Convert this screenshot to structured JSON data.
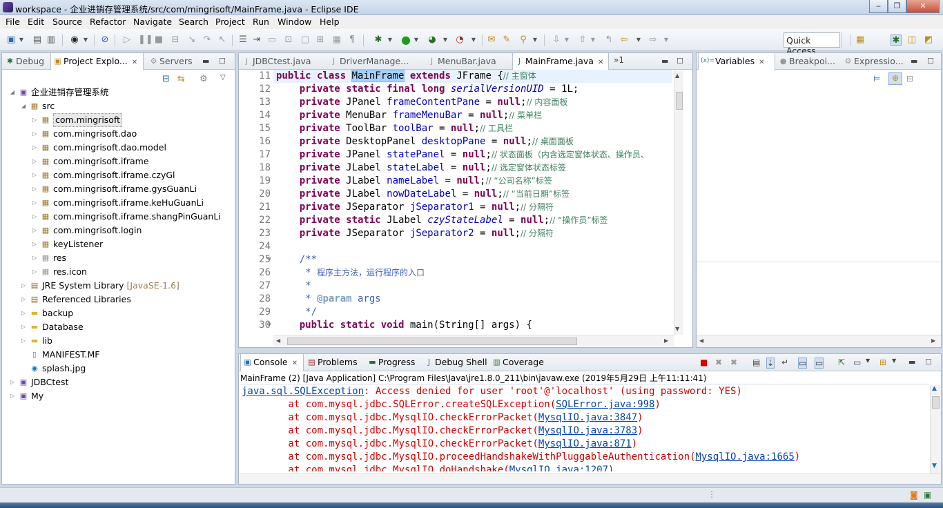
{
  "window": {
    "title": "workspace - 企业进销存管理系统/src/com/mingrisoft/MainFrame.java - Eclipse IDE",
    "minimize": "‒",
    "maximize": "❐",
    "close": "✕"
  },
  "menu": [
    "File",
    "Edit",
    "Source",
    "Refactor",
    "Navigate",
    "Search",
    "Project",
    "Run",
    "Window",
    "Help"
  ],
  "quick_access": "Quick Access",
  "left_tabs": [
    {
      "label": "Debug",
      "active": false
    },
    {
      "label": "Project Explo...",
      "active": true
    },
    {
      "label": "Servers",
      "active": false
    }
  ],
  "tree": [
    {
      "label": "企业进销存管理系统",
      "depth": 0,
      "exp": "◢",
      "icon": "project"
    },
    {
      "label": "src",
      "depth": 1,
      "exp": "◢",
      "icon": "src"
    },
    {
      "label": "com.mingrisoft",
      "depth": 2,
      "exp": "▷",
      "icon": "pkg",
      "selected": true
    },
    {
      "label": "com.mingrisoft.dao",
      "depth": 2,
      "exp": "▷",
      "icon": "pkg"
    },
    {
      "label": "com.mingrisoft.dao.model",
      "depth": 2,
      "exp": "▷",
      "icon": "pkg"
    },
    {
      "label": "com.mingrisoft.iframe",
      "depth": 2,
      "exp": "▷",
      "icon": "pkg"
    },
    {
      "label": "com.mingrisoft.iframe.czyGl",
      "depth": 2,
      "exp": "▷",
      "icon": "pkg"
    },
    {
      "label": "com.mingrisoft.iframe.gysGuanLi",
      "depth": 2,
      "exp": "▷",
      "icon": "pkg"
    },
    {
      "label": "com.mingrisoft.iframe.keHuGuanLi",
      "depth": 2,
      "exp": "▷",
      "icon": "pkg"
    },
    {
      "label": "com.mingrisoft.iframe.shangPinGuanLi",
      "depth": 2,
      "exp": "▷",
      "icon": "pkg"
    },
    {
      "label": "com.mingrisoft.login",
      "depth": 2,
      "exp": "▷",
      "icon": "pkg"
    },
    {
      "label": "keyListener",
      "depth": 2,
      "exp": "▷",
      "icon": "pkg"
    },
    {
      "label": "res",
      "depth": 2,
      "exp": "▷",
      "icon": "pkgempty"
    },
    {
      "label": "res.icon",
      "depth": 2,
      "exp": "▷",
      "icon": "pkgempty"
    },
    {
      "label": "JRE System Library",
      "suffix": "[JavaSE-1.6]",
      "depth": 1,
      "exp": "▷",
      "icon": "lib"
    },
    {
      "label": "Referenced Libraries",
      "depth": 1,
      "exp": "▷",
      "icon": "lib"
    },
    {
      "label": "backup",
      "depth": 1,
      "exp": "▷",
      "icon": "folder"
    },
    {
      "label": "Database",
      "depth": 1,
      "exp": "▷",
      "icon": "folder"
    },
    {
      "label": "lib",
      "depth": 1,
      "exp": "▷",
      "icon": "folder"
    },
    {
      "label": "MANIFEST.MF",
      "depth": 1,
      "exp": "",
      "icon": "file"
    },
    {
      "label": "splash.jpg",
      "depth": 1,
      "exp": "",
      "icon": "image"
    },
    {
      "label": "JDBCtest",
      "depth": 0,
      "exp": "▷",
      "icon": "project"
    },
    {
      "label": "My",
      "depth": 0,
      "exp": "▷",
      "icon": "project"
    }
  ],
  "editor_tabs": [
    {
      "label": "JDBCtest.java",
      "active": false
    },
    {
      "label": "DriverManage...",
      "active": false
    },
    {
      "label": "MenuBar.java",
      "active": false
    },
    {
      "label": "MainFrame.java",
      "active": true
    }
  ],
  "editor_overflow": "»1",
  "code": [
    {
      "n": "11",
      "h": "<span class=\"kw\">public class</span> <span class=\"hl\">MainFrame</span> <span class=\"kw\">extends</span> JFrame {<span class=\"cm\">// 主窗体</span>"
    },
    {
      "n": "12",
      "h": "    <span class=\"kw\">private static final long</span> <span class=\"sfld\">serialVersionUID</span> = 1L;"
    },
    {
      "n": "13",
      "h": "    <span class=\"kw\">private</span> JPanel <span class=\"fld\">frameContentPane</span> = <span class=\"kw\">null</span>;<span class=\"cm\">// 内容面板</span>"
    },
    {
      "n": "14",
      "h": "    <span class=\"kw\">private</span> MenuBar <span class=\"fld\">frameMenuBar</span> = <span class=\"kw\">null</span>;<span class=\"cm\">// 菜单栏</span>"
    },
    {
      "n": "15",
      "h": "    <span class=\"kw\">private</span> ToolBar <span class=\"fld\">toolBar</span> = <span class=\"kw\">null</span>;<span class=\"cm\">// 工具栏</span>"
    },
    {
      "n": "16",
      "h": "    <span class=\"kw\">private</span> DesktopPanel <span class=\"fld\">desktopPane</span> = <span class=\"kw\">null</span>;<span class=\"cm\">// 桌面面板</span>"
    },
    {
      "n": "17",
      "h": "    <span class=\"kw\">private</span> JPanel <span class=\"fld\">statePanel</span> = <span class=\"kw\">null</span>;<span class=\"cm\">// 状态面板（内含选定窗体状态、操作员、</span>"
    },
    {
      "n": "18",
      "h": "    <span class=\"kw\">private</span> JLabel <span class=\"fld\">stateLabel</span> = <span class=\"kw\">null</span>;<span class=\"cm\">// 选定窗体状态标签</span>"
    },
    {
      "n": "19",
      "h": "    <span class=\"kw\">private</span> JLabel <span class=\"fld\">nameLabel</span> = <span class=\"kw\">null</span>;<span class=\"cm\">// “公司名称”标签</span>"
    },
    {
      "n": "20",
      "h": "    <span class=\"kw\">private</span> JLabel <span class=\"fld\">nowDateLabel</span> = <span class=\"kw\">null</span>;<span class=\"cm\">// “当前日期”标签</span>"
    },
    {
      "n": "21",
      "h": "    <span class=\"kw\">private</span> JSeparator <span class=\"fld\">jSeparator1</span> = <span class=\"kw\">null</span>;<span class=\"cm\">// 分隔符</span>"
    },
    {
      "n": "22",
      "h": "    <span class=\"kw\">private static</span> JLabel <span class=\"sfld\">czyStateLabel</span> = <span class=\"kw\">null</span>;<span class=\"cm\">// “操作员”标签</span>"
    },
    {
      "n": "23",
      "h": "    <span class=\"kw\">private</span> JSeparator <span class=\"fld\">jSeparator2</span> = <span class=\"kw\">null</span>;<span class=\"cm\">// 分隔符</span>"
    },
    {
      "n": "24",
      "h": ""
    },
    {
      "n": "25",
      "h": "    <span class=\"jd\">/**</span>",
      "fold": true
    },
    {
      "n": "26",
      "h": "<span class=\"jd\">     * </span><span class=\"cm\" style=\"color:#3f5fbf\">程序主方法，运行程序的入口</span>"
    },
    {
      "n": "27",
      "h": "<span class=\"jd\">     *</span>"
    },
    {
      "n": "28",
      "h": "<span class=\"jd\">     * </span><span class=\"tag\">@param</span><span class=\"jd\"> args</span>"
    },
    {
      "n": "29",
      "h": "<span class=\"jd\">     */</span>"
    },
    {
      "n": "30",
      "h": "    <span class=\"kw\">public static void</span> main(String[] args) {",
      "fold": true
    }
  ],
  "right_tabs": [
    {
      "label": "Variables",
      "active": true
    },
    {
      "label": "Breakpoi...",
      "active": false
    },
    {
      "label": "Expressio...",
      "active": false
    }
  ],
  "bottom_tabs": [
    {
      "label": "Console",
      "active": true
    },
    {
      "label": "Problems",
      "active": false
    },
    {
      "label": "Progress",
      "active": false
    },
    {
      "label": "Debug Shell",
      "active": false
    },
    {
      "label": "Coverage",
      "active": false
    }
  ],
  "console_header": "MainFrame (2) [Java Application] C:\\Program Files\\Java\\jre1.8.0_211\\bin\\javaw.exe (2019年5月29日 上午11:11:41)",
  "console": [
    {
      "pre": "",
      "link": "java.sql.SQLException",
      "post": ": Access denied for user 'root'@'localhost' (using password: YES)"
    },
    {
      "pre": "\tat com.mysql.jdbc.SQLError.createSQLException(",
      "link": "SQLError.java:998",
      "post": ")"
    },
    {
      "pre": "\tat com.mysql.jdbc.MysqlIO.checkErrorPacket(",
      "link": "MysqlIO.java:3847",
      "post": ")"
    },
    {
      "pre": "\tat com.mysql.jdbc.MysqlIO.checkErrorPacket(",
      "link": "MysqlIO.java:3783",
      "post": ")"
    },
    {
      "pre": "\tat com.mysql.jdbc.MysqlIO.checkErrorPacket(",
      "link": "MysqlIO.java:871",
      "post": ")"
    },
    {
      "pre": "\tat com.mysql.jdbc.MysqlIO.proceedHandshakeWithPluggableAuthentication(",
      "link": "MysqlIO.java:1665",
      "post": ")"
    },
    {
      "pre": "\tat com.mysql.jdbc.MysqlIO.doHandshake(",
      "link": "MysqlIO.java:1207",
      "post": ")"
    }
  ]
}
